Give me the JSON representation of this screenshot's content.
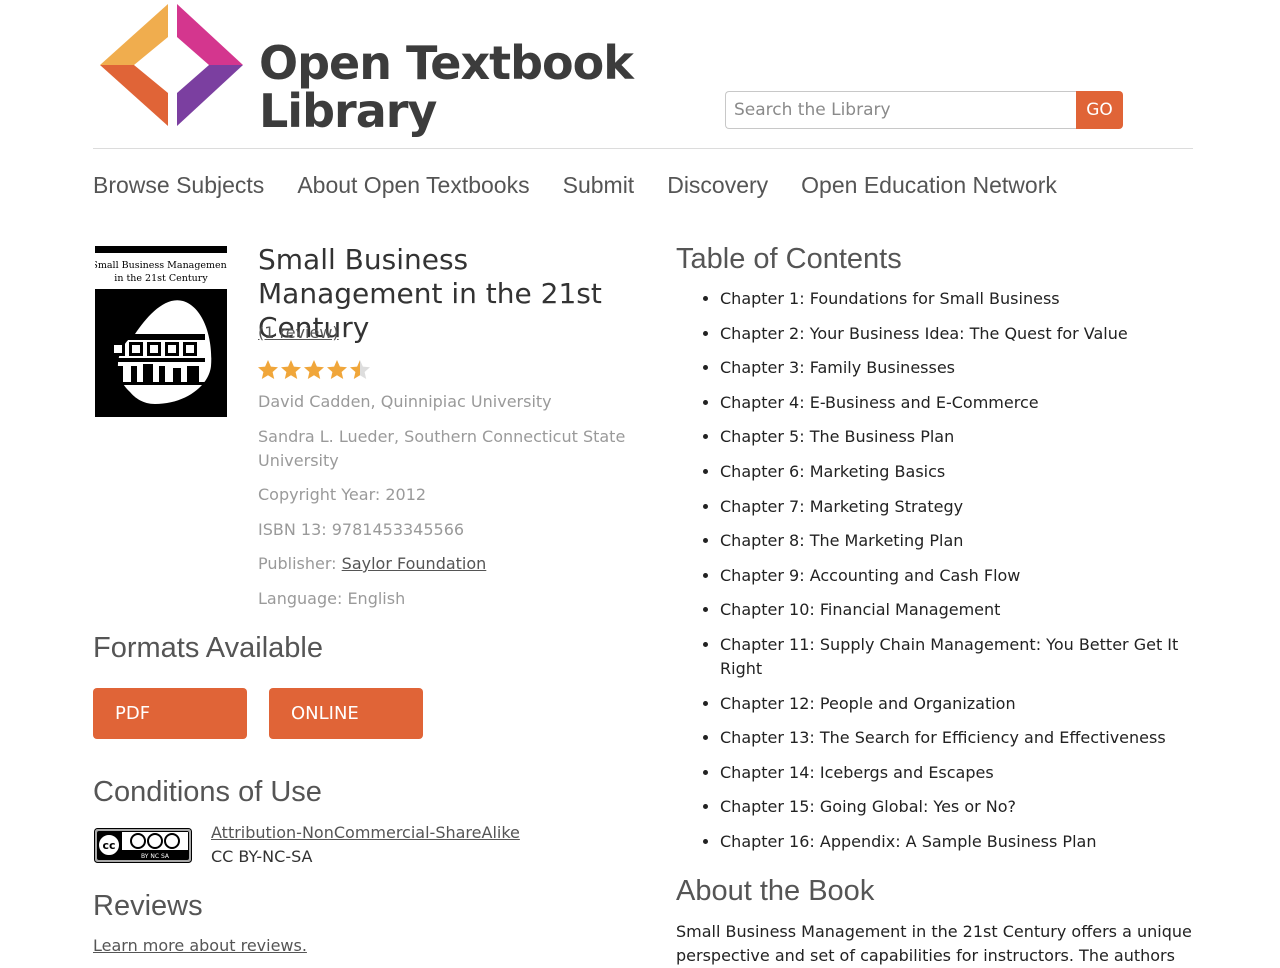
{
  "brand": {
    "line1": "Open Textbook",
    "line2": "Library",
    "colors": {
      "orange": "#f0ad4e",
      "magenta": "#d4368e",
      "purple": "#7b3fa0",
      "red_orange": "#e06437"
    }
  },
  "search": {
    "placeholder": "Search the Library",
    "value": "",
    "button_label": "GO"
  },
  "nav": {
    "items": [
      {
        "label": "Browse Subjects"
      },
      {
        "label": "About Open Textbooks"
      },
      {
        "label": "Submit"
      },
      {
        "label": "Discovery"
      },
      {
        "label": "Open Education Network"
      }
    ]
  },
  "book": {
    "cover_text_line1": "Small Business Management",
    "cover_text_line2": "in the 21st Century",
    "title": "Small Business Management in the 21st Century",
    "review_link": "(1 review)",
    "rating": 4.5,
    "rating_max": 5,
    "authors": [
      "David Cadden, Quinnipiac University",
      "Sandra L. Lueder, Southern Connecticut State University"
    ],
    "copyright": "Copyright Year: 2012",
    "isbn": "ISBN 13: 9781453345566",
    "publisher_label": "Publisher: ",
    "publisher": "Saylor Foundation",
    "language": "Language: English"
  },
  "formats": {
    "title": "Formats Available",
    "buttons": [
      {
        "label": "PDF"
      },
      {
        "label": "ONLINE"
      }
    ]
  },
  "conditions": {
    "title": "Conditions of Use",
    "license_link": "Attribution-NonCommercial-ShareAlike",
    "license_code": "CC BY-NC-SA",
    "badge_text": "BY NC SA"
  },
  "reviews": {
    "title": "Reviews",
    "learn_more": "Learn more about reviews."
  },
  "toc": {
    "title": "Table of Contents",
    "items": [
      "Chapter 1: Foundations for Small Business",
      "Chapter 2: Your Business Idea: The Quest for Value",
      "Chapter 3: Family Businesses",
      "Chapter 4: E-Business and E-Commerce",
      "Chapter 5: The Business Plan",
      "Chapter 6: Marketing Basics",
      "Chapter 7: Marketing Strategy",
      "Chapter 8: The Marketing Plan",
      "Chapter 9: Accounting and Cash Flow",
      "Chapter 10: Financial Management",
      "Chapter 11: Supply Chain Management: You Better Get It Right",
      "Chapter 12: People and Organization",
      "Chapter 13: The Search for Efficiency and Effectiveness",
      "Chapter 14: Icebergs and Escapes",
      "Chapter 15: Going Global: Yes or No?",
      "Chapter 16: Appendix: A Sample Business Plan"
    ]
  },
  "about": {
    "title": "About the Book",
    "text": "Small Business Management in the 21st Century offers a unique perspective and set of capabilities for instructors. The authors"
  }
}
